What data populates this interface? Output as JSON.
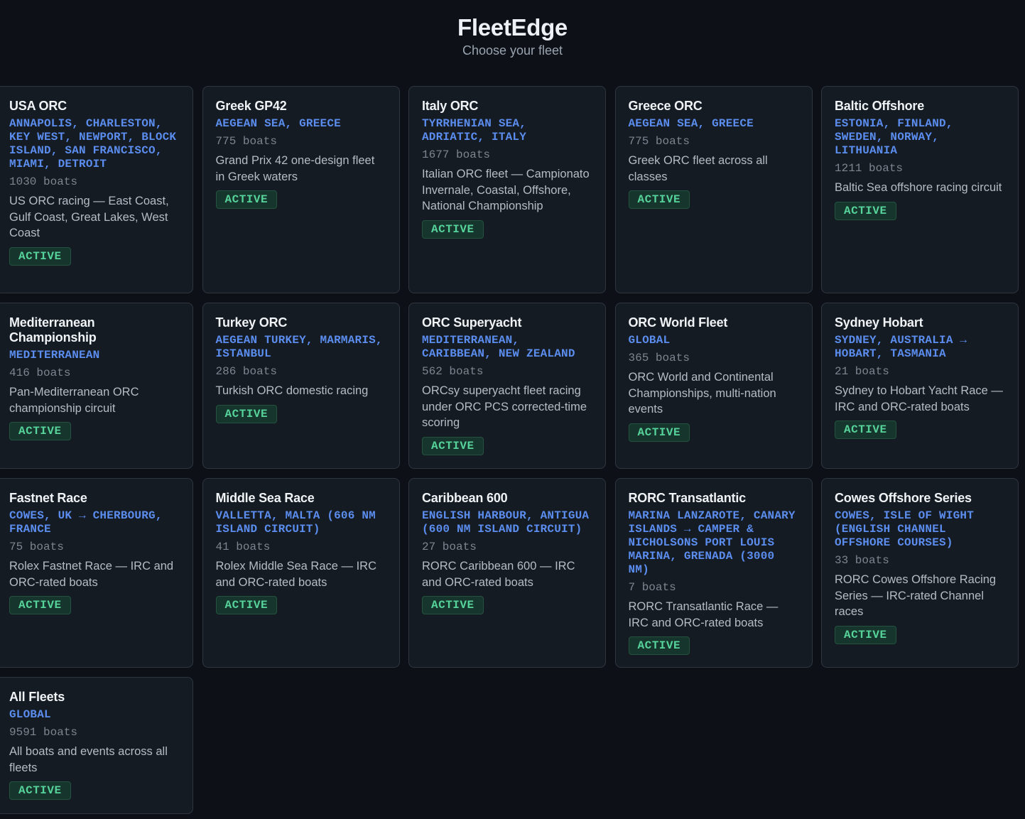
{
  "header": {
    "title": "FleetEdge",
    "subtitle": "Choose your fleet"
  },
  "colors": {
    "background": "#0d1117",
    "card": "#151b23",
    "location": "#5b8def",
    "active": "#56d39a"
  },
  "fleets": [
    {
      "name": "USA ORC",
      "location": "Annapolis, Charleston, Key West, Newport, Block Island, San Francisco, Miami, Detroit",
      "boats": "1030 boats",
      "description": "US ORC racing — East Coast, Gulf Coast, Great Lakes, West Coast",
      "status": "ACTIVE"
    },
    {
      "name": "Greek GP42",
      "location": "Aegean Sea, Greece",
      "boats": "775 boats",
      "description": "Grand Prix 42 one-design fleet in Greek waters",
      "status": "ACTIVE"
    },
    {
      "name": "Italy ORC",
      "location": "Tyrrhenian Sea, Adriatic, Italy",
      "boats": "1677 boats",
      "description": "Italian ORC fleet — Campionato Invernale, Coastal, Offshore, National Championship",
      "status": "ACTIVE"
    },
    {
      "name": "Greece ORC",
      "location": "Aegean Sea, Greece",
      "boats": "775 boats",
      "description": "Greek ORC fleet across all classes",
      "status": "ACTIVE"
    },
    {
      "name": "Baltic Offshore",
      "location": "Estonia, Finland, Sweden, Norway, Lithuania",
      "boats": "1211 boats",
      "description": "Baltic Sea offshore racing circuit",
      "status": "ACTIVE"
    },
    {
      "name": "Mediterranean Championship",
      "location": "Mediterranean",
      "boats": "416 boats",
      "description": "Pan-Mediterranean ORC championship circuit",
      "status": "ACTIVE"
    },
    {
      "name": "Turkey ORC",
      "location": "Aegean Turkey, Marmaris, Istanbul",
      "boats": "286 boats",
      "description": "Turkish ORC domestic racing",
      "status": "ACTIVE"
    },
    {
      "name": "ORC Superyacht",
      "location": "Mediterranean, Caribbean, New Zealand",
      "boats": "562 boats",
      "description": "ORCsy superyacht fleet racing under ORC PCS corrected-time scoring",
      "status": "ACTIVE"
    },
    {
      "name": "ORC World Fleet",
      "location": "Global",
      "boats": "365 boats",
      "description": "ORC World and Continental Championships, multi-nation events",
      "status": "ACTIVE"
    },
    {
      "name": "Sydney Hobart",
      "location": "Sydney, Australia → Hobart, Tasmania",
      "boats": "21 boats",
      "description": "Sydney to Hobart Yacht Race — IRC and ORC-rated boats",
      "status": "ACTIVE"
    },
    {
      "name": "Fastnet Race",
      "location": "Cowes, UK → Cherbourg, France",
      "boats": "75 boats",
      "description": "Rolex Fastnet Race — IRC and ORC-rated boats",
      "status": "ACTIVE"
    },
    {
      "name": "Middle Sea Race",
      "location": "Valletta, Malta (606 nm island circuit)",
      "boats": "41 boats",
      "description": "Rolex Middle Sea Race — IRC and ORC-rated boats",
      "status": "ACTIVE"
    },
    {
      "name": "Caribbean 600",
      "location": "English Harbour, Antigua (600 nm island circuit)",
      "boats": "27 boats",
      "description": "RORC Caribbean 600 — IRC and ORC-rated boats",
      "status": "ACTIVE"
    },
    {
      "name": "RORC Transatlantic",
      "location": "Marina Lanzarote, Canary Islands → Camper & Nicholsons Port Louis Marina, Grenada (3000 nm)",
      "boats": "7 boats",
      "description": "RORC Transatlantic Race — IRC and ORC-rated boats",
      "status": "ACTIVE"
    },
    {
      "name": "Cowes Offshore Series",
      "location": "Cowes, Isle of Wight (English Channel offshore courses)",
      "boats": "33 boats",
      "description": "RORC Cowes Offshore Racing Series — IRC-rated Channel races",
      "status": "ACTIVE"
    },
    {
      "name": "All Fleets",
      "location": "Global",
      "boats": "9591 boats",
      "description": "All boats and events across all fleets",
      "status": "ACTIVE"
    }
  ]
}
